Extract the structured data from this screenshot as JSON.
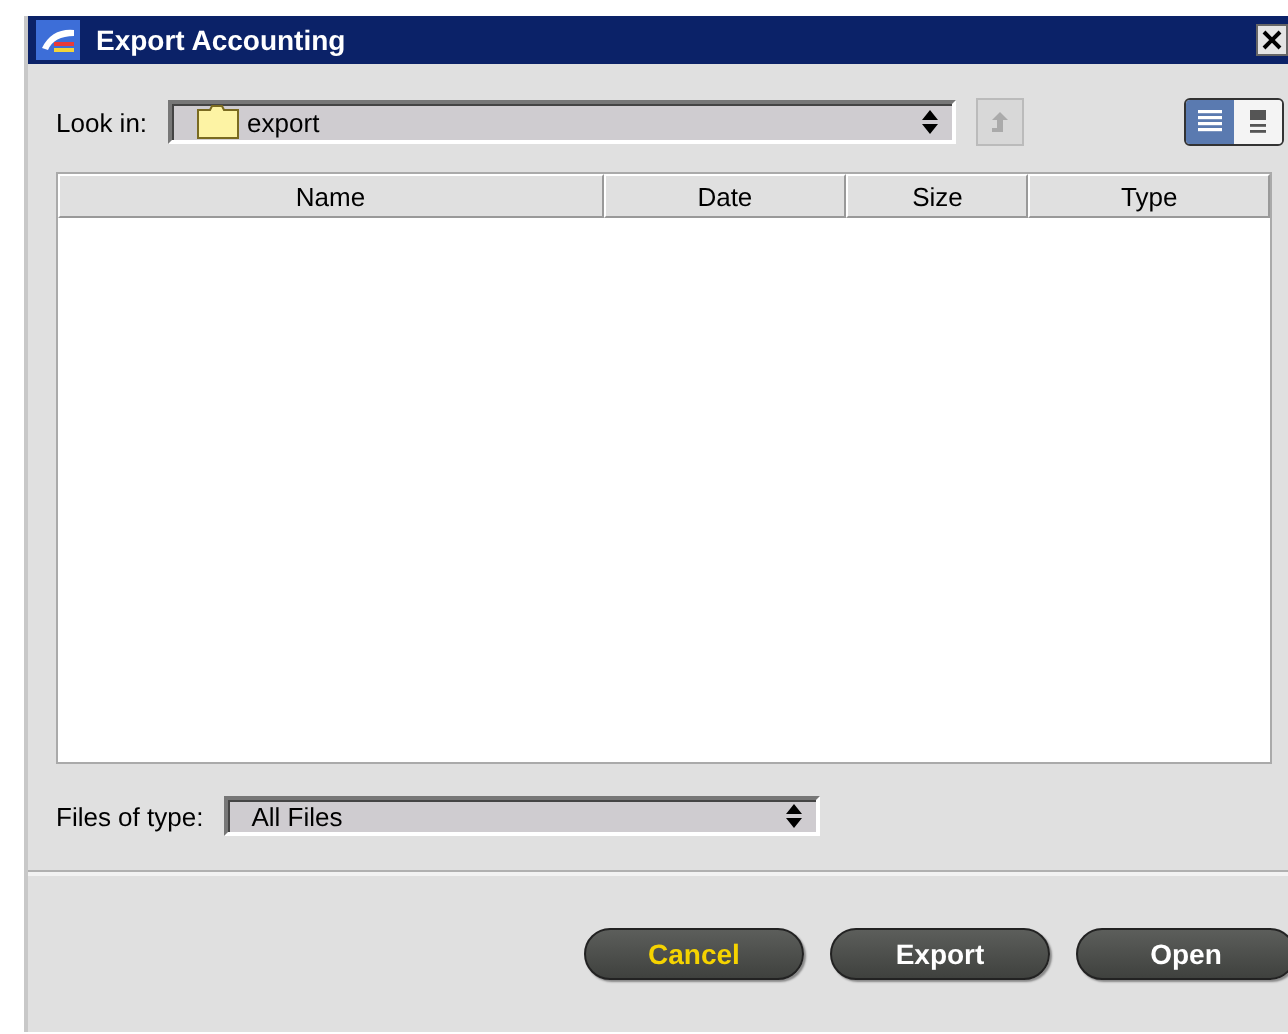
{
  "window": {
    "title": "Export Accounting"
  },
  "look_in": {
    "label": "Look in:",
    "value": "export"
  },
  "up_button": {
    "disabled": true
  },
  "view_modes": [
    {
      "kind": "list",
      "selected": true
    },
    {
      "kind": "details",
      "selected": false
    }
  ],
  "table": {
    "columns": [
      "Name",
      "Date",
      "Size",
      "Type"
    ]
  },
  "files_of_type": {
    "label": "Files of type:",
    "value": "All Files"
  },
  "buttons": [
    {
      "label": "Cancel",
      "highlighted": true
    },
    {
      "label": "Export",
      "highlighted": false
    },
    {
      "label": "Open",
      "highlighted": false
    }
  ]
}
